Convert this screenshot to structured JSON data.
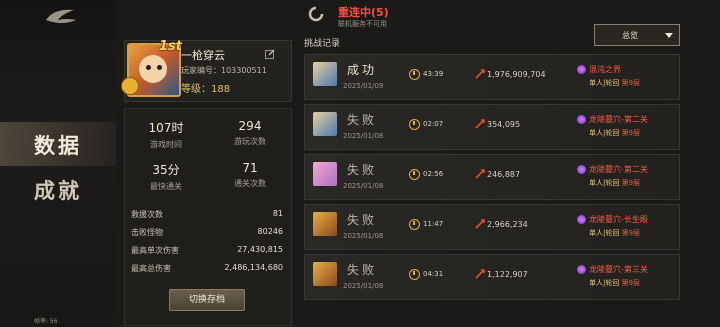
{
  "nav": {
    "data_label": "数据",
    "achievement_label": "成就",
    "fps": "帧率: 56"
  },
  "status": {
    "title": "重连中(5)",
    "subtitle": "联机服务不可用"
  },
  "profile": {
    "rank": "1st",
    "name": "一枪穿云",
    "id_label": "玩家编号：103300511",
    "level_prefix": "等级：",
    "level": "188"
  },
  "stats": {
    "game_time": {
      "value": "107时",
      "label": "游戏时间"
    },
    "play_count": {
      "value": "294",
      "label": "游玩次数"
    },
    "fastest_clear": {
      "value": "35分",
      "label": "最快通关"
    },
    "clear_count": {
      "value": "71",
      "label": "通关次数"
    },
    "rows": [
      {
        "label": "救援次数",
        "value": "81"
      },
      {
        "label": "击败怪物",
        "value": "80246"
      },
      {
        "label": "最高单次伤害",
        "value": "27,430,815"
      },
      {
        "label": "最高总伤害",
        "value": "2,486,134,680"
      }
    ],
    "switch_button": "切换存档"
  },
  "records": {
    "title": "挑战记录",
    "filter": "总览",
    "items": [
      {
        "result": "成功",
        "date": "2025/01/09",
        "time": "43:39",
        "damage": "1,976,909,704",
        "stage": "混沌之界",
        "mode": "单人|轮回",
        "layer": "第9层",
        "color": "#e8e2d0",
        "avatar": [
          "#e8d0a0",
          "#4a7ab0"
        ]
      },
      {
        "result": "失败",
        "date": "2025/01/08",
        "time": "02:07",
        "damage": "354,095",
        "stage": "龙陵墓穴-第二关",
        "mode": "单人|轮回",
        "layer": "第9层",
        "color": "#bdb6a8",
        "avatar": [
          "#e8d0a0",
          "#4a7ab0"
        ]
      },
      {
        "result": "失败",
        "date": "2025/01/08",
        "time": "02:56",
        "damage": "246,887",
        "stage": "龙陵墓穴-第二关",
        "mode": "单人|轮回",
        "layer": "第9层",
        "color": "#bdb6a8",
        "avatar": [
          "#f0a8d0",
          "#b070c0"
        ]
      },
      {
        "result": "失败",
        "date": "2025/01/08",
        "time": "11:47",
        "damage": "2,966,234",
        "stage": "龙陵墓穴-长生殿",
        "mode": "单人|轮回",
        "layer": "第9层",
        "color": "#bdb6a8",
        "avatar": [
          "#e8b040",
          "#8a4a20"
        ]
      },
      {
        "result": "失败",
        "date": "2025/01/08",
        "time": "04:31",
        "damage": "1,122,907",
        "stage": "龙陵墓穴-第三关",
        "mode": "单人|轮回",
        "layer": "第9层",
        "color": "#bdb6a8",
        "avatar": [
          "#e8b040",
          "#8a4a20"
        ]
      }
    ]
  }
}
